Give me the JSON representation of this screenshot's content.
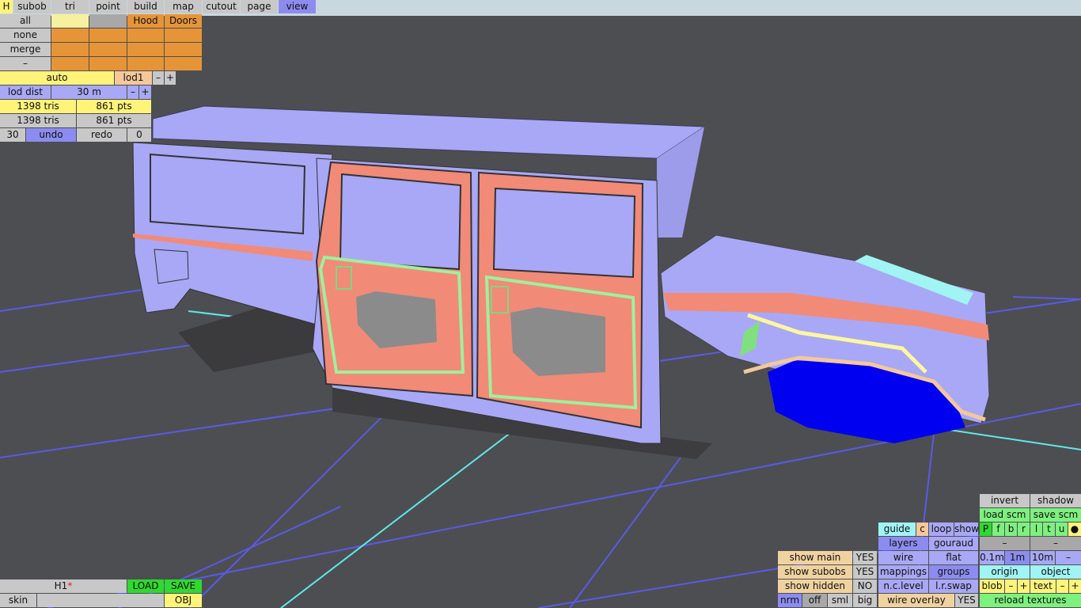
{
  "top_menu": {
    "h": "H",
    "items": [
      "subob",
      "tri",
      "point",
      "build",
      "map",
      "cutout",
      "page",
      "view"
    ],
    "active": "view"
  },
  "selection_panel": {
    "rows": [
      "all",
      "none",
      "merge",
      "–"
    ],
    "group_labels": [
      "Hood",
      "Doors"
    ]
  },
  "lod_panel": {
    "auto": "auto",
    "lod": "lod1",
    "minus": "–",
    "plus": "+",
    "lod_dist_label": "lod dist",
    "lod_dist_value": "30 m",
    "stats1_tris": "1398 tris",
    "stats1_pts": "861 pts",
    "stats2_tris": "1398 tris",
    "stats2_pts": "861 pts",
    "count": "30",
    "undo": "undo",
    "redo": "redo",
    "redo_count": "0"
  },
  "file_panel": {
    "name": "H1",
    "modified_mark": "*",
    "load": "LOAD",
    "save": "SAVE",
    "skin": "skin",
    "obj": "OBJ"
  },
  "show_panel": {
    "rows": [
      {
        "label": "show main",
        "value": "YES"
      },
      {
        "label": "show subobs",
        "value": "YES"
      },
      {
        "label": "show hidden",
        "value": "NO"
      }
    ],
    "nrm": "nrm",
    "off": "off",
    "sml": "sml",
    "big": "big"
  },
  "render_panel": {
    "guide": "guide",
    "c": "c",
    "loop": "loop",
    "show": "show",
    "layers": "layers",
    "gouraud": "gouraud",
    "wire": "wire",
    "flat": "flat",
    "mappings": "mappings",
    "groups": "groups",
    "nc_level": "n.c.level",
    "lr_swap": "l.r.swap",
    "wire_overlay": "wire overlay",
    "wire_overlay_value": "YES"
  },
  "view_panel": {
    "invert": "invert",
    "shadow": "shadow",
    "load_scm": "load scm",
    "save_scm": "save scm",
    "view_letters": [
      "P",
      "f",
      "b",
      "r",
      "l",
      "t",
      "u",
      "●"
    ],
    "minus": "–",
    "plus": "+",
    "grid_01": "0.1m",
    "grid_1": "1m",
    "grid_10": "10m",
    "origin": "origin",
    "object": "object",
    "blob": "blob",
    "text": "text",
    "reload_textures": "reload textures"
  },
  "colors": {
    "background": "#4d4e52",
    "body": "#a8a8f6",
    "door_panel": "#f28a78",
    "accent_blue": "#0000f0",
    "grid_line": "#6060e0",
    "axis_line": "#60e0e0"
  }
}
